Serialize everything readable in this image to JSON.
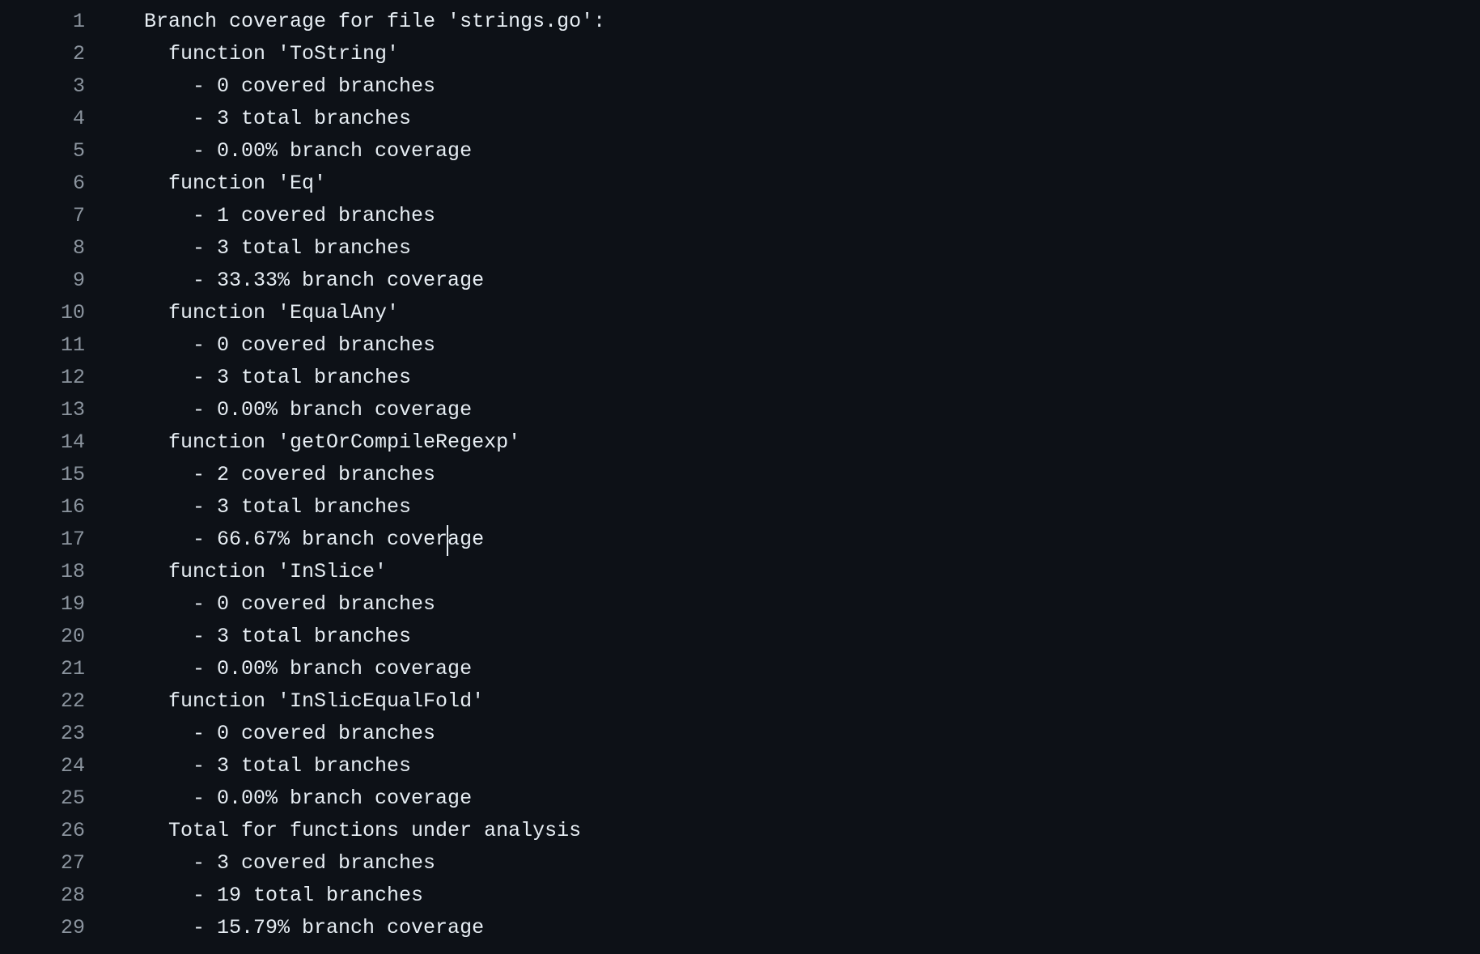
{
  "editor": {
    "lines": [
      {
        "n": "1",
        "text": "Branch coverage for file 'strings.go':"
      },
      {
        "n": "2",
        "text": "  function 'ToString'"
      },
      {
        "n": "3",
        "text": "    - 0 covered branches"
      },
      {
        "n": "4",
        "text": "    - 3 total branches"
      },
      {
        "n": "5",
        "text": "    - 0.00% branch coverage"
      },
      {
        "n": "6",
        "text": "  function 'Eq'"
      },
      {
        "n": "7",
        "text": "    - 1 covered branches"
      },
      {
        "n": "8",
        "text": "    - 3 total branches"
      },
      {
        "n": "9",
        "text": "    - 33.33% branch coverage"
      },
      {
        "n": "10",
        "text": "  function 'EqualAny'"
      },
      {
        "n": "11",
        "text": "    - 0 covered branches"
      },
      {
        "n": "12",
        "text": "    - 3 total branches"
      },
      {
        "n": "13",
        "text": "    - 0.00% branch coverage"
      },
      {
        "n": "14",
        "text": "  function 'getOrCompileRegexp'"
      },
      {
        "n": "15",
        "text": "    - 2 covered branches"
      },
      {
        "n": "16",
        "text": "    - 3 total branches"
      },
      {
        "n": "17",
        "text": "    - 66.67% branch coverage"
      },
      {
        "n": "18",
        "text": "  function 'InSlice'"
      },
      {
        "n": "19",
        "text": "    - 0 covered branches"
      },
      {
        "n": "20",
        "text": "    - 3 total branches"
      },
      {
        "n": "21",
        "text": "    - 0.00% branch coverage"
      },
      {
        "n": "22",
        "text": "  function 'InSlicEqualFold'"
      },
      {
        "n": "23",
        "text": "    - 0 covered branches"
      },
      {
        "n": "24",
        "text": "    - 3 total branches"
      },
      {
        "n": "25",
        "text": "    - 0.00% branch coverage"
      },
      {
        "n": "26",
        "text": "  Total for functions under analysis"
      },
      {
        "n": "27",
        "text": "    - 3 covered branches"
      },
      {
        "n": "28",
        "text": "    - 19 total branches"
      },
      {
        "n": "29",
        "text": "    - 15.79% branch coverage"
      }
    ]
  },
  "colors": {
    "background": "#0d1117",
    "line_number": "#8b949e",
    "text": "#e6edf3"
  }
}
